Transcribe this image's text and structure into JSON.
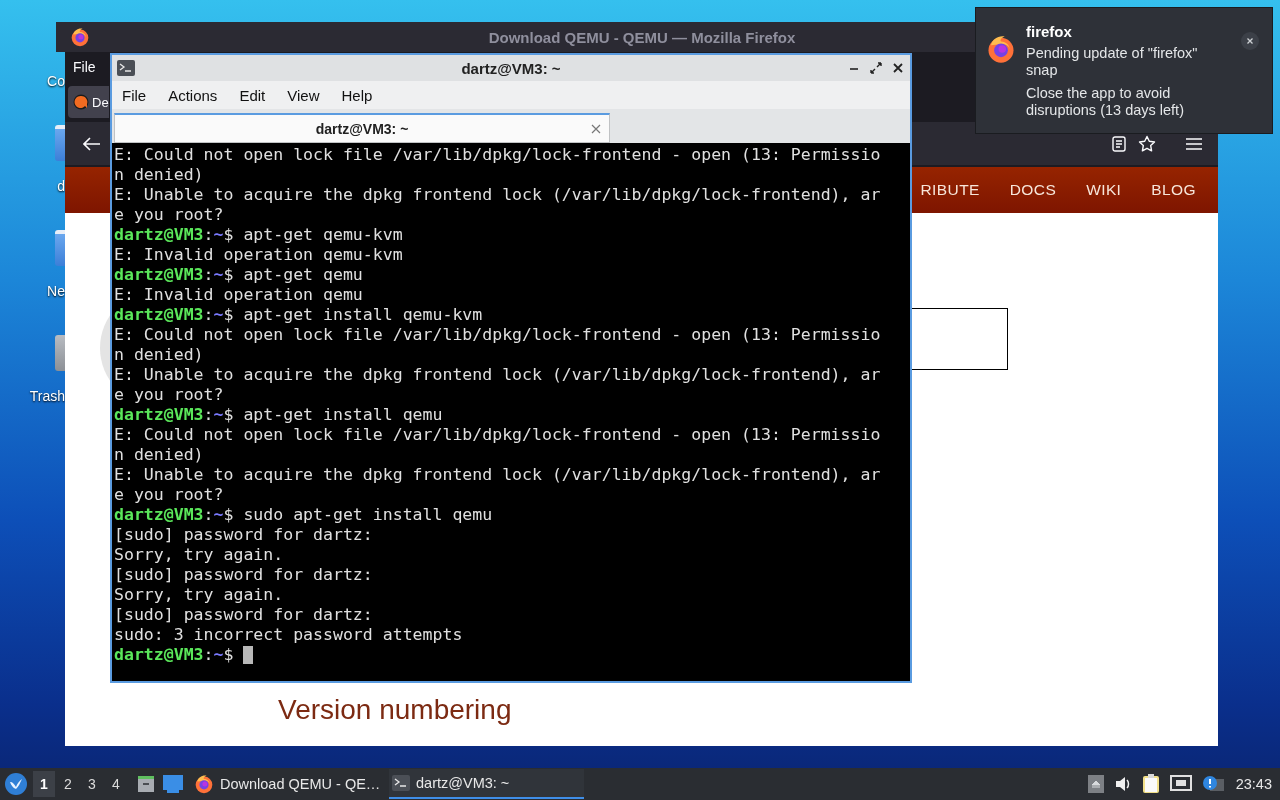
{
  "desktop_icons": [
    {
      "label": "Co",
      "kind": "launcher"
    },
    {
      "label": "d",
      "kind": "folder"
    },
    {
      "label": "Ne",
      "kind": "folder"
    },
    {
      "label": "Trash",
      "kind": "trash"
    }
  ],
  "browser": {
    "title": "Download QEMU - QEMU — Mozilla Firefox",
    "menu": [
      "File"
    ],
    "tab": {
      "label": "De"
    },
    "nav_links": [
      "RIBUTE",
      "DOCS",
      "WIKI",
      "BLOG"
    ],
    "page_heading": "Version numbering"
  },
  "terminal": {
    "title": "dartz@VM3: ~",
    "menu": [
      "File",
      "Actions",
      "Edit",
      "View",
      "Help"
    ],
    "tabs": [
      {
        "label": "dartz@VM3: ~",
        "selected": true
      }
    ],
    "lines": [
      {
        "kind": "output",
        "text": "E: Could not open lock file /var/lib/dpkg/lock-frontend - open (13: Permissio",
        "cursor": false
      },
      {
        "kind": "output",
        "text": "n denied)",
        "cursor": false
      },
      {
        "kind": "output",
        "text": "E: Unable to acquire the dpkg frontend lock (/var/lib/dpkg/lock-frontend), ar",
        "cursor": false
      },
      {
        "kind": "output",
        "text": "e you root?",
        "cursor": false
      },
      {
        "kind": "prompt",
        "user": "dartz@VM3",
        "sep": ":",
        "path": "~",
        "sign": "$",
        "command": "apt-get qemu-kvm",
        "cursor": false
      },
      {
        "kind": "output",
        "text": "E: Invalid operation qemu-kvm",
        "cursor": false
      },
      {
        "kind": "prompt",
        "user": "dartz@VM3",
        "sep": ":",
        "path": "~",
        "sign": "$",
        "command": "apt-get qemu",
        "cursor": false
      },
      {
        "kind": "output",
        "text": "E: Invalid operation qemu",
        "cursor": false
      },
      {
        "kind": "prompt",
        "user": "dartz@VM3",
        "sep": ":",
        "path": "~",
        "sign": "$",
        "command": "apt-get install qemu-kvm",
        "cursor": false
      },
      {
        "kind": "output",
        "text": "E: Could not open lock file /var/lib/dpkg/lock-frontend - open (13: Permissio",
        "cursor": false
      },
      {
        "kind": "output",
        "text": "n denied)",
        "cursor": false
      },
      {
        "kind": "output",
        "text": "E: Unable to acquire the dpkg frontend lock (/var/lib/dpkg/lock-frontend), ar",
        "cursor": false
      },
      {
        "kind": "output",
        "text": "e you root?",
        "cursor": false
      },
      {
        "kind": "prompt",
        "user": "dartz@VM3",
        "sep": ":",
        "path": "~",
        "sign": "$",
        "command": "apt-get install qemu",
        "cursor": false
      },
      {
        "kind": "output",
        "text": "E: Could not open lock file /var/lib/dpkg/lock-frontend - open (13: Permissio",
        "cursor": false
      },
      {
        "kind": "output",
        "text": "n denied)",
        "cursor": false
      },
      {
        "kind": "output",
        "text": "E: Unable to acquire the dpkg frontend lock (/var/lib/dpkg/lock-frontend), ar",
        "cursor": false
      },
      {
        "kind": "output",
        "text": "e you root?",
        "cursor": false
      },
      {
        "kind": "prompt",
        "user": "dartz@VM3",
        "sep": ":",
        "path": "~",
        "sign": "$",
        "command": "sudo apt-get install qemu",
        "cursor": false
      },
      {
        "kind": "output",
        "text": "[sudo] password for dartz:",
        "cursor": false
      },
      {
        "kind": "output",
        "text": "Sorry, try again.",
        "cursor": false
      },
      {
        "kind": "output",
        "text": "[sudo] password for dartz:",
        "cursor": false
      },
      {
        "kind": "output",
        "text": "Sorry, try again.",
        "cursor": false
      },
      {
        "kind": "output",
        "text": "[sudo] password for dartz:",
        "cursor": false
      },
      {
        "kind": "output",
        "text": "sudo: 3 incorrect password attempts",
        "cursor": false
      },
      {
        "kind": "prompt",
        "user": "dartz@VM3",
        "sep": ":",
        "path": "~",
        "sign": "$",
        "cursor": true
      }
    ]
  },
  "notification": {
    "app": "firefox",
    "summary": "Pending update of \"firefox\" snap",
    "body": "Close the app to avoid disruptions (13 days left)"
  },
  "taskbar": {
    "desktops": [
      {
        "label": "1",
        "selected": true
      },
      {
        "label": "2",
        "selected": false
      },
      {
        "label": "3",
        "selected": false
      },
      {
        "label": "4",
        "selected": false
      }
    ],
    "tasks": [
      {
        "label": "Download QEMU - QE…",
        "kind": "browser",
        "selected": false
      },
      {
        "label": "dartz@VM3: ~",
        "kind": "terminal",
        "selected": true
      }
    ],
    "clock": "23:43"
  }
}
